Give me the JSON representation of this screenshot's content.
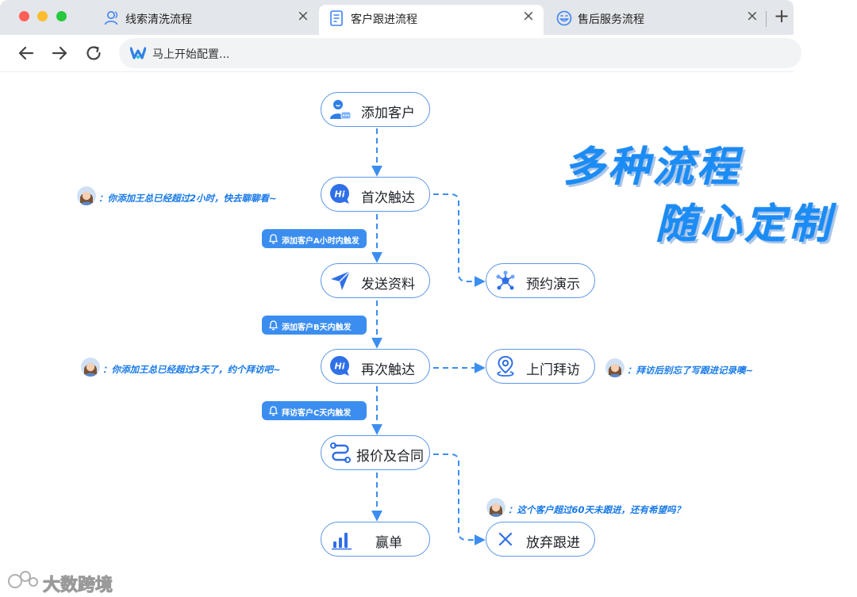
{
  "browser": {
    "tabs": [
      {
        "label": "线索清洗流程",
        "icon": "user-outline-icon",
        "active": false
      },
      {
        "label": "客户跟进流程",
        "icon": "document-icon",
        "active": true
      },
      {
        "label": "售后服务流程",
        "icon": "smile-face-icon",
        "active": false
      }
    ],
    "close_glyph": "×",
    "new_tab_glyph": "+",
    "address_text": "马上开始配置...",
    "colors": {
      "close": "#ff5f57",
      "minimize": "#febc2e",
      "maximize": "#28c840",
      "tabbar": "#e3e6ea"
    }
  },
  "flow": {
    "nodes": {
      "add_customer": {
        "label": "添加客户",
        "icon": "customer-chat-icon"
      },
      "first_touch": {
        "label": "首次触达",
        "icon": "hi-chat-icon"
      },
      "send_material": {
        "label": "发送资料",
        "icon": "paper-plane-icon"
      },
      "book_demo": {
        "label": "预约演示",
        "icon": "network-nodes-icon"
      },
      "second_touch": {
        "label": "再次触达",
        "icon": "hi-chat-icon"
      },
      "home_visit": {
        "label": "上门拜访",
        "icon": "location-pin-icon"
      },
      "quote_contract": {
        "label": "报价及合同",
        "icon": "route-icon"
      },
      "won": {
        "label": "赢单",
        "icon": "bar-chart-icon"
      },
      "abandon": {
        "label": "放弃跟进",
        "icon": "close-x-icon"
      }
    },
    "triggers": [
      {
        "label": "添加客户A小时内触发"
      },
      {
        "label": "添加客户B天内触发"
      },
      {
        "label": "拜访客户C天内触发"
      }
    ],
    "comments": [
      {
        "text": "：你添加王总已经超过2小时，快去聊聊看~"
      },
      {
        "text": "：你添加王总已经超过3天了，约个拜访吧~"
      },
      {
        "text": "：拜访后别忘了写跟进记录噢~"
      },
      {
        "text": "：这个客户超过60天未跟进，还有希望吗？"
      }
    ],
    "colors": {
      "accent": "#3b8ef0",
      "node_border": "#5a96e6",
      "comment": "#1779e8"
    }
  },
  "slogan": {
    "line1": "多种流程",
    "line2": "随心定制"
  },
  "watermark": {
    "text": "大数跨境"
  }
}
